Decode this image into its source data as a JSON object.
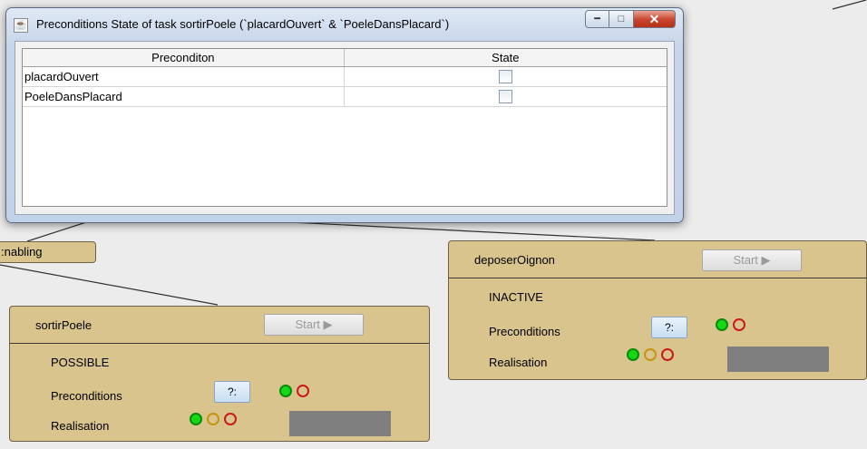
{
  "dialog": {
    "title": "Preconditions State of task sortirPoele  (`placardOuvert` & `PoeleDansPlacard`)",
    "app_icon": "java-cup-icon",
    "controls": {
      "minimize": "minimize-icon",
      "maximize": "maximize-icon",
      "close": "close-icon"
    },
    "table": {
      "headers": [
        "Preconditon",
        "State"
      ],
      "rows": [
        {
          "precondition": "placardOuvert",
          "state": false
        },
        {
          "precondition": "PoeleDansPlacard",
          "state": false
        }
      ]
    }
  },
  "enabling_tag": {
    "label": ":nabling"
  },
  "tasks": [
    {
      "name": "sortirPoele",
      "start_label": "Start ▶",
      "state": "POSSIBLE",
      "preconditions_label": "Preconditions",
      "query_label": "?:",
      "realisation_label": "Realisation"
    },
    {
      "name": "deposerOignon",
      "start_label": "Start ▶",
      "state": "INACTIVE",
      "preconditions_label": "Preconditions",
      "query_label": "?:",
      "realisation_label": "Realisation"
    }
  ],
  "colors": {
    "panel": "#d8c48c",
    "green": "#16d916",
    "orange": "#c59410",
    "red": "#cc1a1a",
    "progress": "#7f7f7f"
  }
}
